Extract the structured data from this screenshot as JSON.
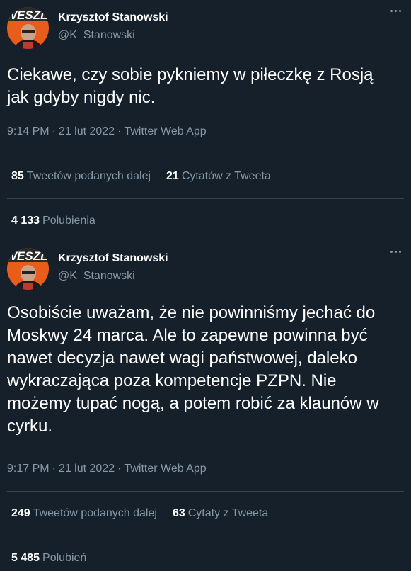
{
  "tweets": [
    {
      "author": {
        "display_name": "Krzysztof Stanowski",
        "handle": "@K_Stanowski",
        "avatar_text": "WESZLO"
      },
      "text": "Ciekawe, czy sobie pykniemy w piłeczkę z Rosją jak gdyby nigdy nic.",
      "time": "9:14 PM",
      "date": "21 lut 2022",
      "source": "Twitter Web App",
      "retweets": {
        "count": "85",
        "label": "Tweetów podanych dalej"
      },
      "quotes": {
        "count": "21",
        "label": "Cytatów z Tweeta"
      },
      "likes": {
        "count": "4 133",
        "label": "Polubienia"
      }
    },
    {
      "author": {
        "display_name": "Krzysztof Stanowski",
        "handle": "@K_Stanowski",
        "avatar_text": "WESZLO"
      },
      "text": "Osobiście uważam, że nie powinniśmy jechać do Moskwy 24 marca. Ale to zapewne powinna być nawet decyzja nawet wagi państwowej, daleko wykraczająca poza kompetencje PZPN. Nie możemy tupać nogą, a potem robić za klaunów w cyrku.",
      "time": "9:17 PM",
      "date": "21 lut 2022",
      "source": "Twitter Web App",
      "retweets": {
        "count": "249",
        "label": "Tweetów podanych dalej"
      },
      "quotes": {
        "count": "63",
        "label": "Cytaty z Tweeta"
      },
      "likes": {
        "count": "5 485",
        "label": "Polubień"
      }
    }
  ],
  "meta_separator": "·",
  "colors": {
    "background": "#15202b",
    "text": "#ffffff",
    "muted": "#8899a6",
    "divider": "#38444d",
    "avatar_orange": "#e85d1a"
  }
}
